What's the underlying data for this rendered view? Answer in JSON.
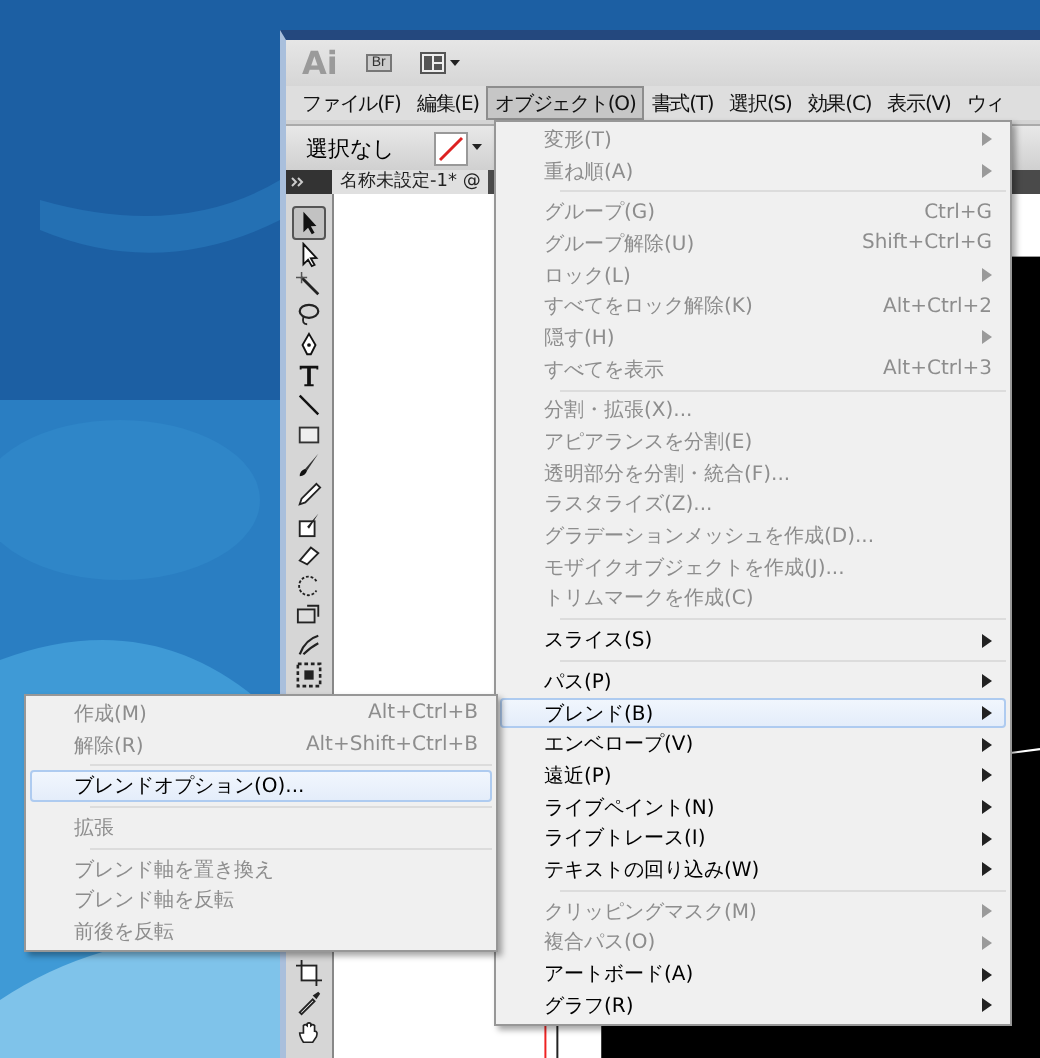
{
  "app_bar": {
    "logo": "Ai",
    "bridge_button": "Br"
  },
  "menu_bar": [
    {
      "label": "ファイル(F)",
      "selected": false
    },
    {
      "label": "編集(E)",
      "selected": false
    },
    {
      "label": "オブジェクト(O)",
      "selected": true
    },
    {
      "label": "書式(T)",
      "selected": false
    },
    {
      "label": "選択(S)",
      "selected": false
    },
    {
      "label": "効果(C)",
      "selected": false
    },
    {
      "label": "表示(V)",
      "selected": false
    },
    {
      "label": "ウィ",
      "selected": false
    }
  ],
  "control_bar": {
    "selection_status": "選択なし"
  },
  "document_tab": {
    "title": "名称未設定-1* @"
  },
  "tools_top": [
    {
      "kind": "selection",
      "selected": true
    },
    {
      "kind": "direct-selection",
      "selected": false
    },
    {
      "kind": "magic-wand",
      "selected": false
    },
    {
      "kind": "lasso",
      "selected": false
    },
    {
      "kind": "pen",
      "selected": false
    },
    {
      "kind": "type",
      "selected": false
    },
    {
      "kind": "line",
      "selected": false
    },
    {
      "kind": "rectangle",
      "selected": false
    },
    {
      "kind": "paintbrush",
      "selected": false
    },
    {
      "kind": "pencil",
      "selected": false
    },
    {
      "kind": "blob-brush",
      "selected": false
    },
    {
      "kind": "eraser",
      "selected": false
    },
    {
      "kind": "rotate",
      "selected": false
    },
    {
      "kind": "scale",
      "selected": false
    },
    {
      "kind": "warp",
      "selected": false
    },
    {
      "kind": "free-transform",
      "selected": false
    }
  ],
  "tools_bottom": [
    {
      "kind": "artboard",
      "selected": false
    },
    {
      "kind": "eyedropper",
      "selected": false
    },
    {
      "kind": "hand",
      "selected": false
    }
  ],
  "object_menu": {
    "items": [
      {
        "kind": "item",
        "label": "変形(T)",
        "disabled": true,
        "submenu": true,
        "selected": false
      },
      {
        "kind": "item",
        "label": "重ね順(A)",
        "disabled": true,
        "submenu": true,
        "selected": false
      },
      {
        "kind": "separator"
      },
      {
        "kind": "item",
        "label": "グループ(G)",
        "shortcut": "Ctrl+G",
        "disabled": true,
        "submenu": false,
        "selected": false
      },
      {
        "kind": "item",
        "label": "グループ解除(U)",
        "shortcut": "Shift+Ctrl+G",
        "disabled": true,
        "submenu": false,
        "selected": false
      },
      {
        "kind": "item",
        "label": "ロック(L)",
        "disabled": true,
        "submenu": true,
        "selected": false
      },
      {
        "kind": "item",
        "label": "すべてをロック解除(K)",
        "shortcut": "Alt+Ctrl+2",
        "disabled": true,
        "submenu": false,
        "selected": false
      },
      {
        "kind": "item",
        "label": "隠す(H)",
        "disabled": true,
        "submenu": true,
        "selected": false
      },
      {
        "kind": "item",
        "label": "すべてを表示",
        "shortcut": "Alt+Ctrl+3",
        "disabled": true,
        "submenu": false,
        "selected": false
      },
      {
        "kind": "separator"
      },
      {
        "kind": "item",
        "label": "分割・拡張(X)...",
        "disabled": true,
        "submenu": false,
        "selected": false
      },
      {
        "kind": "item",
        "label": "アピアランスを分割(E)",
        "disabled": true,
        "submenu": false,
        "selected": false
      },
      {
        "kind": "item",
        "label": "透明部分を分割・統合(F)...",
        "disabled": true,
        "submenu": false,
        "selected": false
      },
      {
        "kind": "item",
        "label": "ラスタライズ(Z)...",
        "disabled": true,
        "submenu": false,
        "selected": false
      },
      {
        "kind": "item",
        "label": "グラデーションメッシュを作成(D)...",
        "disabled": true,
        "submenu": false,
        "selected": false
      },
      {
        "kind": "item",
        "label": "モザイクオブジェクトを作成(J)...",
        "disabled": true,
        "submenu": false,
        "selected": false
      },
      {
        "kind": "item",
        "label": "トリムマークを作成(C)",
        "disabled": true,
        "submenu": false,
        "selected": false
      },
      {
        "kind": "separator"
      },
      {
        "kind": "item",
        "label": "スライス(S)",
        "disabled": false,
        "submenu": true,
        "selected": false
      },
      {
        "kind": "separator"
      },
      {
        "kind": "item",
        "label": "パス(P)",
        "disabled": false,
        "submenu": true,
        "selected": false
      },
      {
        "kind": "item",
        "label": "ブレンド(B)",
        "disabled": false,
        "submenu": true,
        "selected": true
      },
      {
        "kind": "item",
        "label": "エンベロープ(V)",
        "disabled": false,
        "submenu": true,
        "selected": false
      },
      {
        "kind": "item",
        "label": "遠近(P)",
        "disabled": false,
        "submenu": true,
        "selected": false
      },
      {
        "kind": "item",
        "label": "ライブペイント(N)",
        "disabled": false,
        "submenu": true,
        "selected": false
      },
      {
        "kind": "item",
        "label": "ライブトレース(I)",
        "disabled": false,
        "submenu": true,
        "selected": false
      },
      {
        "kind": "item",
        "label": "テキストの回り込み(W)",
        "disabled": false,
        "submenu": true,
        "selected": false
      },
      {
        "kind": "separator"
      },
      {
        "kind": "item",
        "label": "クリッピングマスク(M)",
        "disabled": true,
        "submenu": true,
        "selected": false
      },
      {
        "kind": "item",
        "label": "複合パス(O)",
        "disabled": true,
        "submenu": true,
        "selected": false
      },
      {
        "kind": "item",
        "label": "アートボード(A)",
        "disabled": false,
        "submenu": true,
        "selected": false
      },
      {
        "kind": "item",
        "label": "グラフ(R)",
        "disabled": false,
        "submenu": true,
        "selected": false
      }
    ]
  },
  "blend_submenu": {
    "items": [
      {
        "kind": "item",
        "label": "作成(M)",
        "shortcut": "Alt+Ctrl+B",
        "disabled": true,
        "submenu": false,
        "selected": false
      },
      {
        "kind": "item",
        "label": "解除(R)",
        "shortcut": "Alt+Shift+Ctrl+B",
        "disabled": true,
        "submenu": false,
        "selected": false
      },
      {
        "kind": "separator"
      },
      {
        "kind": "item",
        "label": "ブレンドオプション(O)...",
        "disabled": false,
        "submenu": false,
        "selected": true
      },
      {
        "kind": "separator"
      },
      {
        "kind": "item",
        "label": "拡張",
        "disabled": true,
        "submenu": false,
        "selected": false
      },
      {
        "kind": "separator"
      },
      {
        "kind": "item",
        "label": "ブレンド軸を置き換え",
        "disabled": true,
        "submenu": false,
        "selected": false
      },
      {
        "kind": "item",
        "label": "ブレンド軸を反転",
        "disabled": true,
        "submenu": false,
        "selected": false
      },
      {
        "kind": "item",
        "label": "前後を反転",
        "disabled": true,
        "submenu": false,
        "selected": false
      }
    ]
  }
}
